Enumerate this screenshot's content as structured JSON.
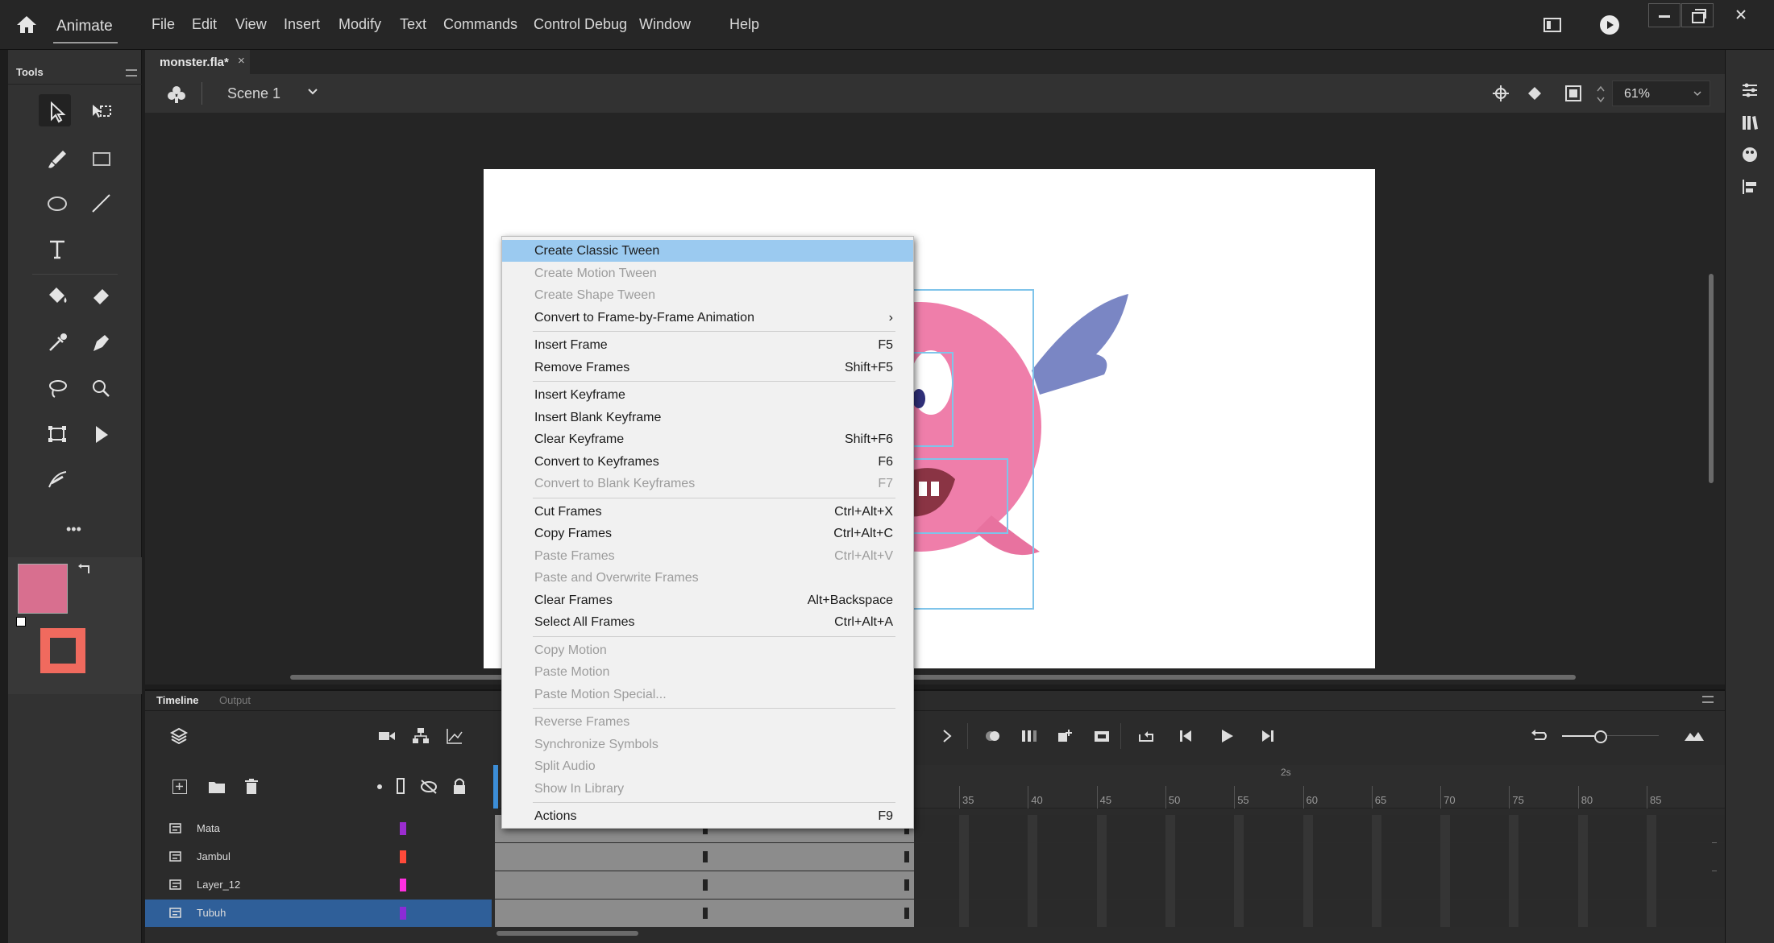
{
  "app": {
    "name": "Animate"
  },
  "menu": [
    "File",
    "Edit",
    "View",
    "Insert",
    "Modify",
    "Text",
    "Commands",
    "Control",
    "Debug",
    "Window",
    "Help"
  ],
  "tools_panel": {
    "title": "Tools",
    "more": "•••"
  },
  "document": {
    "tab": "monster.fla*",
    "scene": "Scene 1",
    "zoom": "61%"
  },
  "timeline": {
    "tabs": [
      "Timeline",
      "Output"
    ],
    "ruler": [
      "35",
      "40",
      "45",
      "50",
      "55",
      "60",
      "65",
      "70",
      "75",
      "80",
      "85"
    ],
    "seconds_marker": "2s",
    "layers": [
      {
        "name": "Mata",
        "color": "#9b2dd0",
        "selected": false
      },
      {
        "name": "Jambul",
        "color": "#ff4a3a",
        "selected": false
      },
      {
        "name": "Layer_12",
        "color": "#ff2fe0",
        "selected": false
      },
      {
        "name": "Tubuh",
        "color": "#8c2bd6",
        "selected": true
      }
    ]
  },
  "context_menu": {
    "groups": [
      [
        {
          "label": "Create Classic Tween",
          "shortcut": "",
          "disabled": false,
          "highlighted": true
        },
        {
          "label": "Create Motion Tween",
          "shortcut": "",
          "disabled": true
        },
        {
          "label": "Create Shape Tween",
          "shortcut": "",
          "disabled": true
        },
        {
          "label": "Convert to Frame-by-Frame Animation",
          "shortcut": "›",
          "disabled": false
        }
      ],
      [
        {
          "label": "Insert Frame",
          "shortcut": "F5",
          "disabled": false
        },
        {
          "label": "Remove Frames",
          "shortcut": "Shift+F5",
          "disabled": false
        }
      ],
      [
        {
          "label": "Insert Keyframe",
          "shortcut": "",
          "disabled": false
        },
        {
          "label": "Insert Blank Keyframe",
          "shortcut": "",
          "disabled": false
        },
        {
          "label": "Clear Keyframe",
          "shortcut": "Shift+F6",
          "disabled": false
        },
        {
          "label": "Convert to Keyframes",
          "shortcut": "F6",
          "disabled": false
        },
        {
          "label": "Convert to Blank Keyframes",
          "shortcut": "F7",
          "disabled": true
        }
      ],
      [
        {
          "label": "Cut Frames",
          "shortcut": "Ctrl+Alt+X",
          "disabled": false
        },
        {
          "label": "Copy Frames",
          "shortcut": "Ctrl+Alt+C",
          "disabled": false
        },
        {
          "label": "Paste Frames",
          "shortcut": "Ctrl+Alt+V",
          "disabled": true
        },
        {
          "label": "Paste and Overwrite Frames",
          "shortcut": "",
          "disabled": true
        },
        {
          "label": "Clear Frames",
          "shortcut": "Alt+Backspace",
          "disabled": false
        },
        {
          "label": "Select All Frames",
          "shortcut": "Ctrl+Alt+A",
          "disabled": false
        }
      ],
      [
        {
          "label": "Copy Motion",
          "shortcut": "",
          "disabled": true
        },
        {
          "label": "Paste Motion",
          "shortcut": "",
          "disabled": true
        },
        {
          "label": "Paste Motion Special...",
          "shortcut": "",
          "disabled": true
        }
      ],
      [
        {
          "label": "Reverse Frames",
          "shortcut": "",
          "disabled": true
        },
        {
          "label": "Synchronize Symbols",
          "shortcut": "",
          "disabled": true
        },
        {
          "label": "Split Audio",
          "shortcut": "",
          "disabled": true
        },
        {
          "label": "Show In Library",
          "shortcut": "",
          "disabled": true
        }
      ],
      [
        {
          "label": "Actions",
          "shortcut": "F9",
          "disabled": false
        }
      ]
    ]
  },
  "colors": {
    "fill": "#d86f8f",
    "stroke": "#f06a5e",
    "highlight": "#9bcaf0",
    "monster": "#ef7eaa",
    "wing": "#7a86c4"
  }
}
